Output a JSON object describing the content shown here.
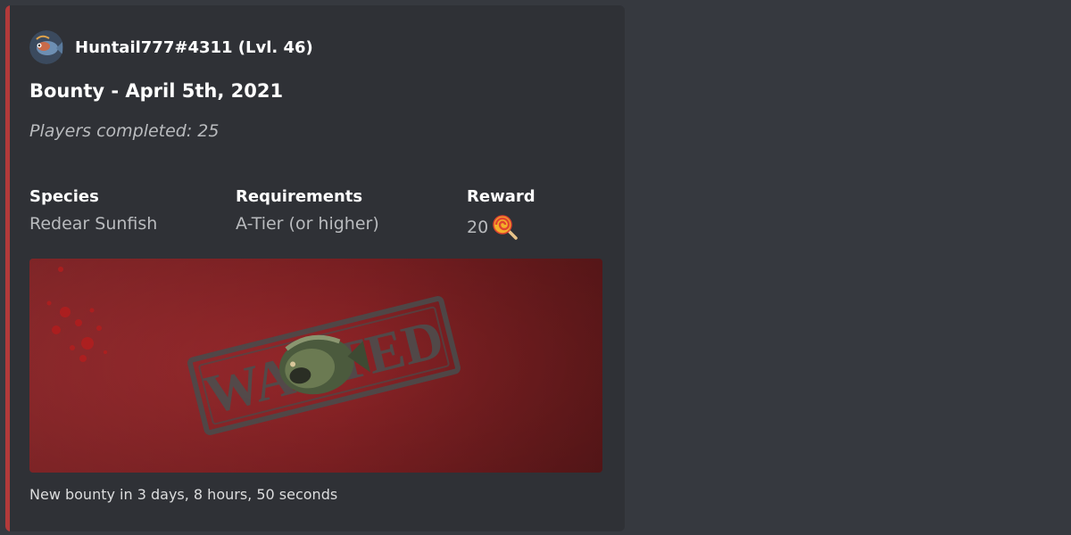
{
  "embed": {
    "accent_color": "#b33a3a",
    "author": {
      "name": "Huntail777#4311 (Lvl. 46)",
      "avatar_icon": "fish-avatar-icon"
    },
    "title": "Bounty - April 5th, 2021",
    "description": "Players completed: 25",
    "fields": [
      {
        "name": "Species",
        "value": "Redear Sunfish"
      },
      {
        "name": "Requirements",
        "value": "A-Tier (or higher)"
      },
      {
        "name": "Reward",
        "value": "20",
        "icon": "lollipop-icon"
      }
    ],
    "image": {
      "stamp_text": "WANTED",
      "background_color": "#a53033"
    },
    "footer": "New bounty in 3 days, 8 hours, 50 seconds"
  }
}
